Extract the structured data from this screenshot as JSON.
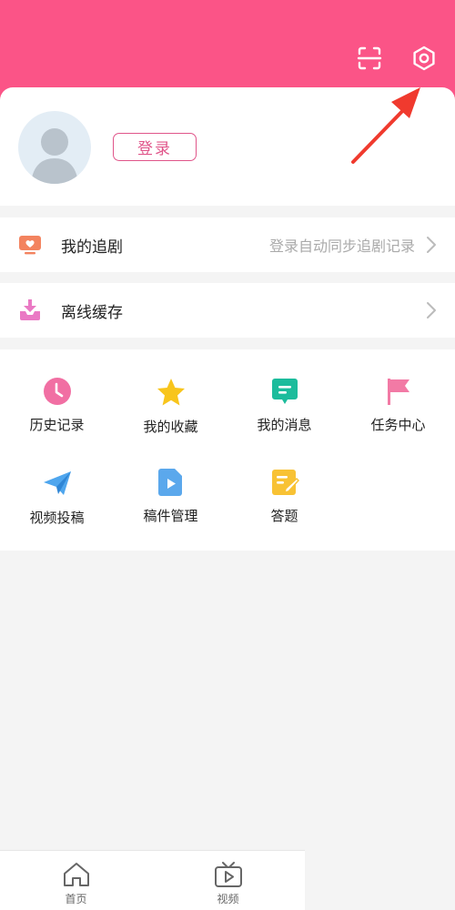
{
  "colors": {
    "header_bg": "#fb5487",
    "accent": "#e0558a",
    "page_bg": "#f4f4f4",
    "hint": "#aaaaaa"
  },
  "header": {
    "icons": [
      "scan-icon",
      "gear-icon"
    ]
  },
  "profile": {
    "login_label": "登录"
  },
  "follow": {
    "label": "我的追剧",
    "hint": "登录自动同步追剧记录"
  },
  "offline": {
    "label": "离线缓存"
  },
  "grid": {
    "items": [
      {
        "label": "历史记录",
        "icon": "clock-icon"
      },
      {
        "label": "我的收藏",
        "icon": "star-icon"
      },
      {
        "label": "我的消息",
        "icon": "message-icon"
      },
      {
        "label": "任务中心",
        "icon": "flag-icon"
      },
      {
        "label": "视频投稿",
        "icon": "paper-plane-icon"
      },
      {
        "label": "稿件管理",
        "icon": "video-file-icon"
      },
      {
        "label": "答题",
        "icon": "edit-note-icon"
      }
    ]
  },
  "tabbar": {
    "tabs": [
      {
        "label": "首页",
        "icon": "home-icon"
      },
      {
        "label": "视频",
        "icon": "tv-icon"
      }
    ]
  }
}
